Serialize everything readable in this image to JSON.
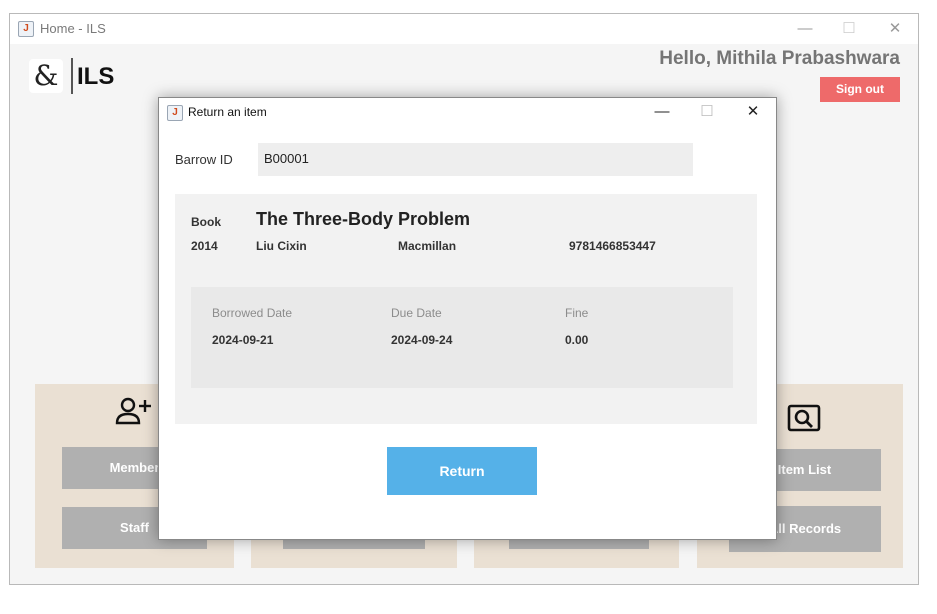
{
  "main_window": {
    "title": "Home - ILS",
    "controls": {
      "minimize": "—",
      "maximize": "☐",
      "close": "✕"
    }
  },
  "header": {
    "logo_glyph": "&",
    "logo_text": "ILS",
    "greeting": "Hello, Mithila Prabashwara",
    "sign_out_label": "Sign out"
  },
  "dashboard": {
    "cards": [
      {
        "icon": "add-user-icon",
        "buttons": [
          "Member",
          "Staff"
        ]
      },
      {
        "icon": "",
        "buttons": [
          "",
          ""
        ]
      },
      {
        "icon": "",
        "buttons": [
          "",
          ""
        ]
      },
      {
        "icon": "search-icon",
        "buttons": [
          "Item List",
          "All Records"
        ]
      }
    ]
  },
  "dialog": {
    "title": "Return an item",
    "controls": {
      "minimize": "—",
      "maximize": "☐",
      "close": "✕"
    },
    "borrow_id_label": "Barrow ID",
    "borrow_id_value": "B00001",
    "item": {
      "type": "Book",
      "title": "The Three-Body Problem",
      "year": "2014",
      "author": "Liu Cixin",
      "publisher": "Macmillan",
      "isbn": "9781466853447"
    },
    "loan": {
      "borrowed_label": "Borrowed Date",
      "borrowed_value": "2024-09-21",
      "due_label": "Due Date",
      "due_value": "2024-09-24",
      "fine_label": "Fine",
      "fine_value": "0.00"
    },
    "return_label": "Return"
  },
  "colors": {
    "accent_blue": "#55b1e8",
    "signout_red": "#ee6a6a",
    "card_beige": "#eae0d3",
    "card_button_gray": "#b0b0b0"
  }
}
